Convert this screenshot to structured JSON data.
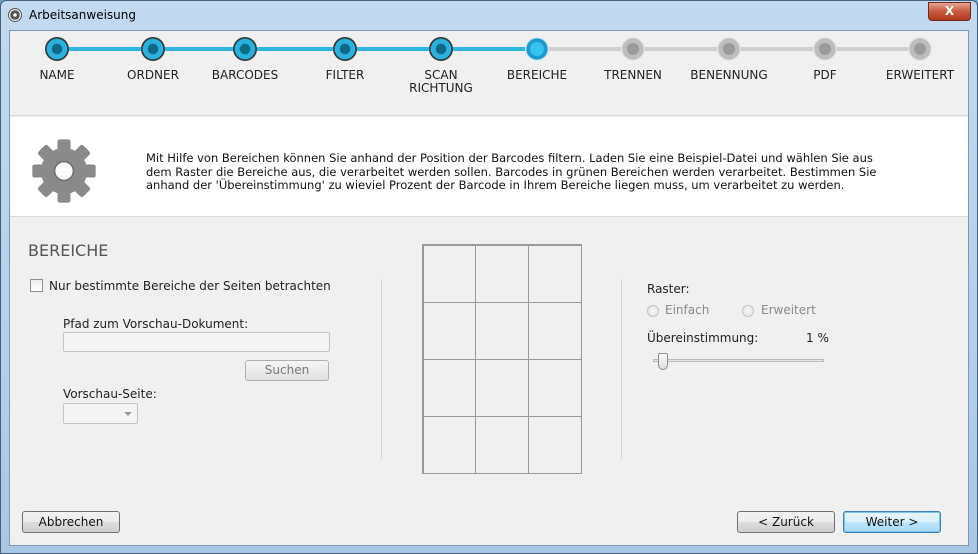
{
  "window": {
    "title": "Arbeitsanweisung",
    "close_label": "X"
  },
  "steps": [
    {
      "label": "NAME",
      "state": "done"
    },
    {
      "label": "ORDNER",
      "state": "done"
    },
    {
      "label": "BARCODES",
      "state": "done"
    },
    {
      "label": "FILTER",
      "state": "done"
    },
    {
      "label": "SCAN\nRICHTUNG",
      "state": "done"
    },
    {
      "label": "BEREICHE",
      "state": "active"
    },
    {
      "label": "TRENNEN",
      "state": "todo"
    },
    {
      "label": "BENENNUNG",
      "state": "todo"
    },
    {
      "label": "PDF",
      "state": "todo"
    },
    {
      "label": "ERWEITERT",
      "state": "todo"
    }
  ],
  "info": {
    "icon": "gear-icon",
    "text": "Mit Hilfe von Bereichen können Sie anhand der Position der Barcodes filtern. Laden Sie eine Beispiel-Datei und wählen Sie aus dem Raster die Bereiche aus, die verarbeitet werden sollen. Barcodes in grünen Bereichen werden verarbeitet. Bestimmen Sie anhand der 'Übereinstimmung' zu wieviel Prozent der Barcode in Ihrem Bereiche liegen muss, um verarbeitet zu werden."
  },
  "bereiche": {
    "title": "BEREICHE",
    "checkbox_label": "Nur bestimmte Bereiche der Seiten betrachten",
    "checkbox_checked": false,
    "path_label": "Pfad zum Vorschau-Dokument:",
    "path_value": "",
    "search_button": "Suchen",
    "page_label": "Vorschau-Seite:",
    "page_value": ""
  },
  "raster": {
    "label": "Raster:",
    "option_simple": "Einfach",
    "option_extended": "Erweitert",
    "match_label": "Übereinstimmung:",
    "match_value": "1 %",
    "match_percent": 1
  },
  "grid": {
    "rows": 4,
    "cols": 3
  },
  "footer": {
    "cancel": "Abbrechen",
    "back": "< Zurück",
    "next": "Weiter >"
  },
  "colors": {
    "step_done": "#2fb6df",
    "step_todo": "#cfcfcf",
    "accent": "#1b9acb"
  }
}
